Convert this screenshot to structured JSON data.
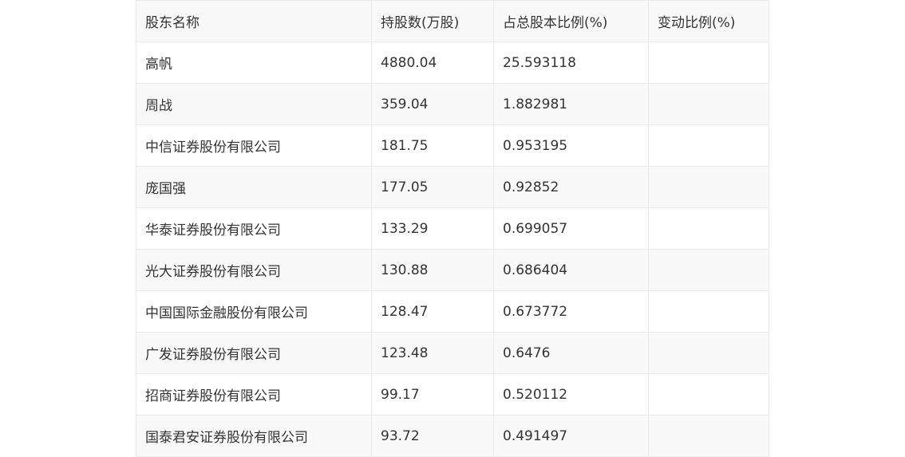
{
  "table": {
    "headers": [
      "股东名称",
      "持股数(万股)",
      "占总股本比例(%)",
      "变动比例(%)"
    ],
    "rows": [
      [
        "高帆",
        "4880.04",
        "25.593118",
        ""
      ],
      [
        "周战",
        "359.04",
        "1.882981",
        ""
      ],
      [
        "中信证券股份有限公司",
        "181.75",
        "0.953195",
        ""
      ],
      [
        "庞国强",
        "177.05",
        "0.92852",
        ""
      ],
      [
        "华泰证券股份有限公司",
        "133.29",
        "0.699057",
        ""
      ],
      [
        "光大证券股份有限公司",
        "130.88",
        "0.686404",
        ""
      ],
      [
        "中国国际金融股份有限公司",
        "128.47",
        "0.673772",
        ""
      ],
      [
        "广发证券股份有限公司",
        "123.48",
        "0.6476",
        ""
      ],
      [
        "招商证券股份有限公司",
        "99.17",
        "0.520112",
        ""
      ],
      [
        "国泰君安证券股份有限公司",
        "93.72",
        "0.491497",
        ""
      ]
    ]
  }
}
